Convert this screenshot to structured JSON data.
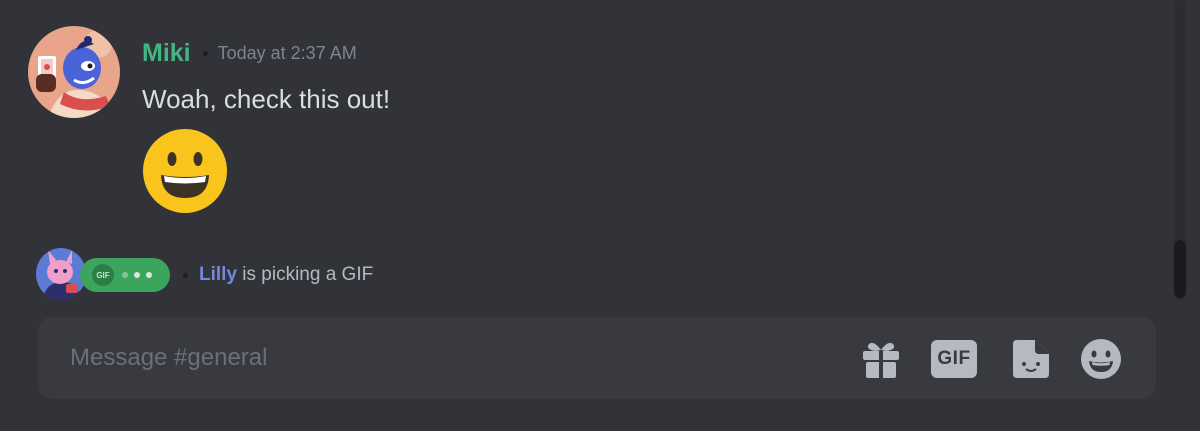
{
  "message": {
    "username": "Miki",
    "timestamp": "Today at 2:37 AM",
    "text": "Woah, check this out!",
    "emoji": "grinning-face"
  },
  "typing": {
    "gif_badge": "GIF",
    "user": "Lilly",
    "action": " is picking a GIF"
  },
  "composer": {
    "placeholder": "Message #general",
    "value": "",
    "gif_label": "GIF",
    "icons": [
      "gift-icon",
      "gif-icon",
      "sticker-icon",
      "emoji-icon"
    ]
  },
  "colors": {
    "background": "#313338",
    "composer": "#383a40",
    "username": "#43b581",
    "typing_user": "#7289da",
    "typing_pill": "#3ba55d"
  }
}
